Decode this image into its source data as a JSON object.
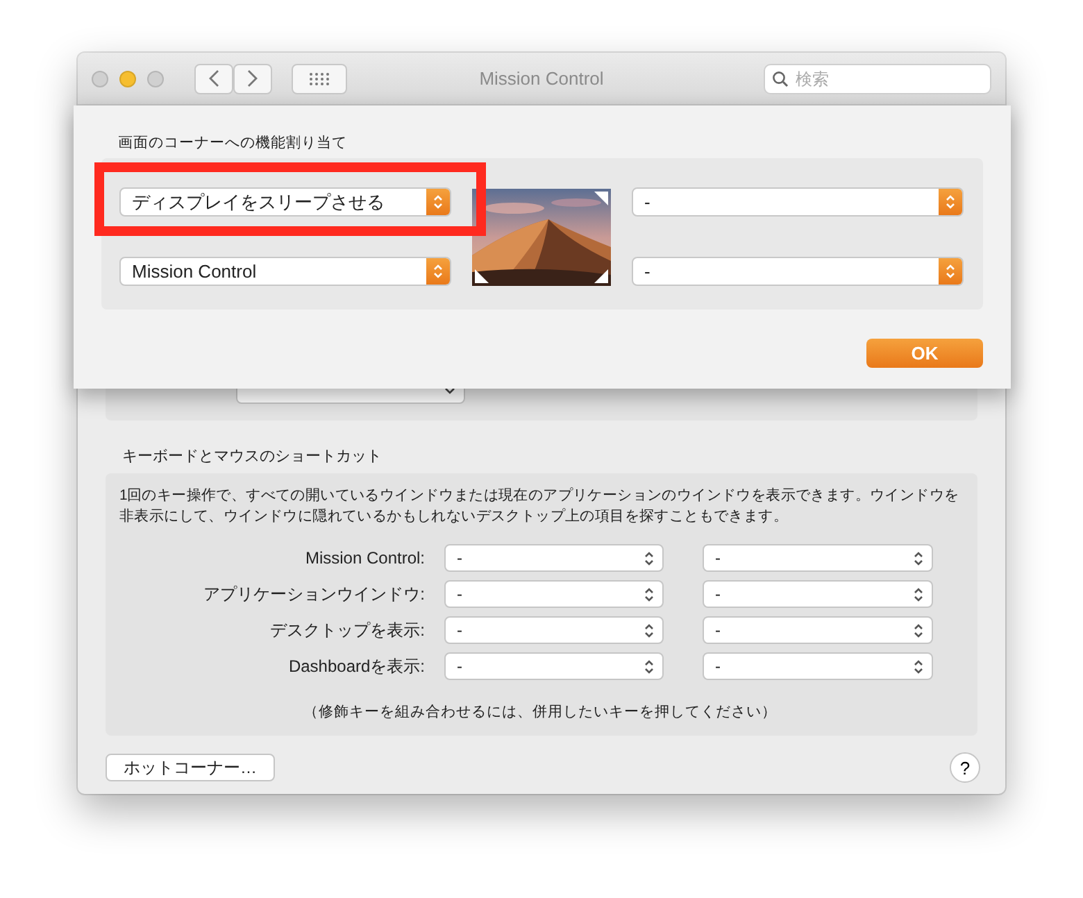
{
  "window": {
    "title": "Mission Control",
    "search": {
      "placeholder": "検索"
    }
  },
  "sheet": {
    "section_title": "画面のコーナーへの機能割り当て",
    "corners": [
      {
        "value": "ディスプレイをスリープさせる"
      },
      {
        "value": "-"
      },
      {
        "value": "Mission Control"
      },
      {
        "value": "-"
      }
    ],
    "ok": "OK",
    "highlight": {
      "kind": "frame"
    }
  },
  "dashboard": {
    "kind": "select"
  },
  "shortcuts": {
    "title": "キーボードとマウスのショートカット",
    "description": "1回のキー操作で、すべての開いているウインドウまたは現在のアプリケーションのウインドウを表示できます。ウインドウを非表示にして、ウインドウに隠れているかもしれないデスクトップ上の項目を探すこともできます。",
    "rows": [
      {
        "label": "Mission Control:",
        "keyboard": "-",
        "mouse": "-"
      },
      {
        "label": "アプリケーションウインドウ:",
        "keyboard": "-",
        "mouse": "-"
      },
      {
        "label": "デスクトップを表示:",
        "keyboard": "-",
        "mouse": "-"
      },
      {
        "label": "Dashboardを表示:",
        "keyboard": "-",
        "mouse": "-"
      }
    ],
    "note": "（修飾キーを組み合わせるには、併用したいキーを押してください）"
  },
  "hot_corners_button": "ホットコーナー…",
  "help": "?"
}
